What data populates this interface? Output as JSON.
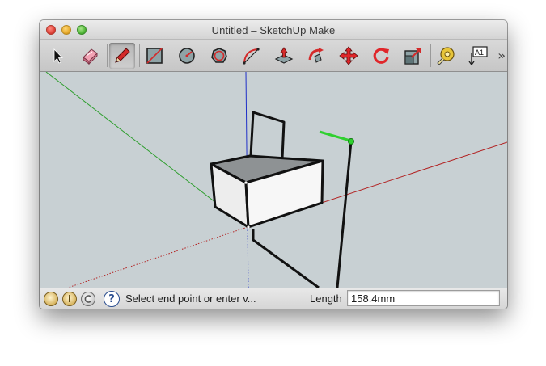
{
  "window": {
    "title": "Untitled – SketchUp Make"
  },
  "toolbar": {
    "tools": [
      {
        "name": "select-tool",
        "icon": "arrow-cursor-icon",
        "active": false
      },
      {
        "name": "eraser-tool",
        "icon": "eraser-icon",
        "active": false
      },
      {
        "name": "line-tool",
        "icon": "pencil-icon",
        "active": true
      },
      {
        "name": "rectangle-tool",
        "icon": "rectangle-icon",
        "active": false
      },
      {
        "name": "circle-tool",
        "icon": "circle-icon",
        "active": false
      },
      {
        "name": "polygon-tool",
        "icon": "polygon-icon",
        "active": false
      },
      {
        "name": "arc-tool",
        "icon": "arc-icon",
        "active": false
      },
      {
        "name": "push-pull-tool",
        "icon": "push-pull-icon",
        "active": false
      },
      {
        "name": "follow-me-tool",
        "icon": "follow-me-icon",
        "active": false
      },
      {
        "name": "move-tool",
        "icon": "move-icon",
        "active": false
      },
      {
        "name": "rotate-tool",
        "icon": "rotate-icon",
        "active": false
      },
      {
        "name": "scale-tool",
        "icon": "scale-icon",
        "active": false
      },
      {
        "name": "tape-measure-tool",
        "icon": "tape-measure-icon",
        "active": false
      },
      {
        "name": "text-tool",
        "icon": "text-icon",
        "active": false
      }
    ],
    "text_tool_glyph": "A1",
    "overflow_glyph": "»"
  },
  "statusbar": {
    "icons": [
      "geo-location-icon",
      "credits-icon",
      "user-account-icon"
    ],
    "help_glyph": "?",
    "prompt": "Select end point or enter v...",
    "length_label": "Length",
    "length_value": "158.4mm"
  },
  "colors": {
    "viewport_bg": "#c8d0d3",
    "axis_red": "#b22222",
    "axis_green": "#2e9e2e",
    "axis_blue": "#1f2fc8",
    "endpoint_green": "#2fd02f"
  }
}
